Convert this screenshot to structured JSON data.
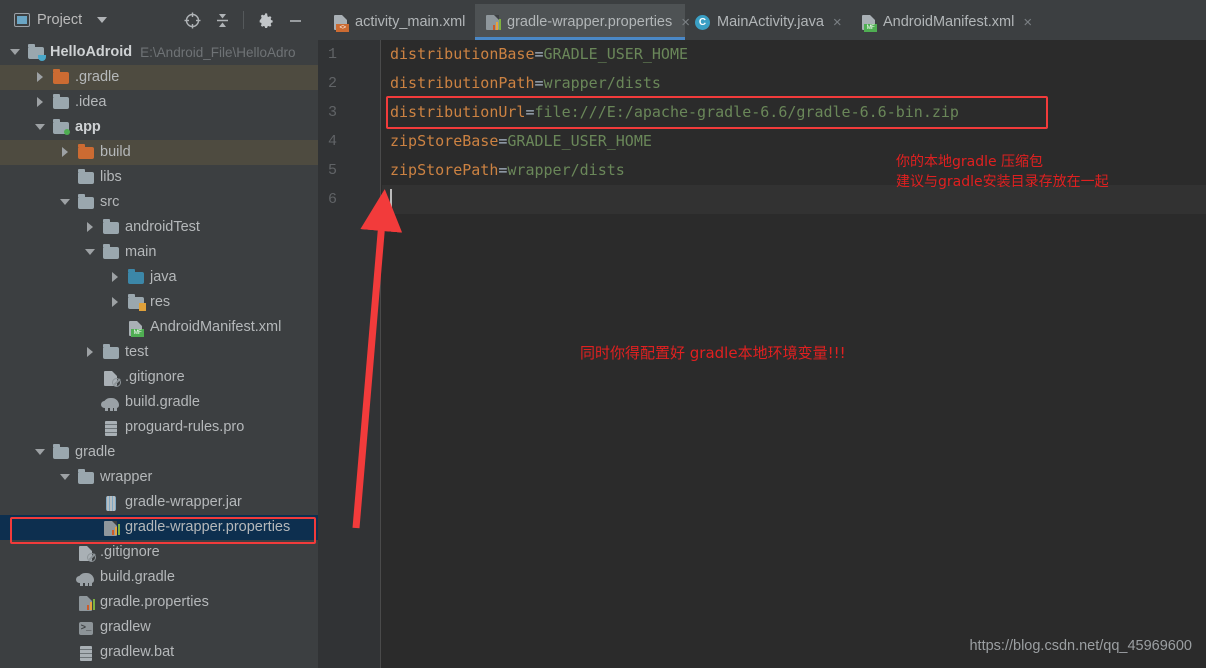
{
  "window": {
    "tool_window_title": "Project",
    "project_path": "E:\\Android_File\\HelloAdroid"
  },
  "toolbar": {
    "icons": [
      {
        "name": "locate-icon",
        "glyph": "⊕"
      },
      {
        "name": "collapse-all-icon",
        "glyph": "⤓"
      },
      {
        "name": "settings-gear-icon",
        "glyph": "⚙"
      },
      {
        "name": "minimize-icon",
        "glyph": "—"
      }
    ]
  },
  "tree": {
    "items": [
      {
        "label": "HelloAdroid",
        "note": "E:\\Android_File\\HelloAdro",
        "indent": 0,
        "twisty": "down",
        "icon": "folder-module",
        "bold": true,
        "state": "normal"
      },
      {
        "label": ".gradle",
        "note": "",
        "indent": 1,
        "twisty": "right",
        "icon": "folder-orange",
        "bold": false,
        "state": "olive"
      },
      {
        "label": ".idea",
        "note": "",
        "indent": 1,
        "twisty": "right",
        "icon": "folder-gray",
        "bold": false,
        "state": "normal"
      },
      {
        "label": "app",
        "note": "",
        "indent": 1,
        "twisty": "down",
        "icon": "folder-module-green",
        "bold": true,
        "state": "normal"
      },
      {
        "label": "build",
        "note": "",
        "indent": 2,
        "twisty": "right",
        "icon": "folder-orange",
        "bold": false,
        "state": "olive"
      },
      {
        "label": "libs",
        "note": "",
        "indent": 2,
        "twisty": "none",
        "icon": "folder-gray",
        "bold": false,
        "state": "normal"
      },
      {
        "label": "src",
        "note": "",
        "indent": 2,
        "twisty": "down",
        "icon": "folder-gray",
        "bold": false,
        "state": "normal"
      },
      {
        "label": "androidTest",
        "note": "",
        "indent": 3,
        "twisty": "right",
        "icon": "folder-gray",
        "bold": false,
        "state": "normal"
      },
      {
        "label": "main",
        "note": "",
        "indent": 3,
        "twisty": "down",
        "icon": "folder-gray",
        "bold": false,
        "state": "normal"
      },
      {
        "label": "java",
        "note": "",
        "indent": 4,
        "twisty": "right",
        "icon": "folder-blue",
        "bold": false,
        "state": "normal"
      },
      {
        "label": "res",
        "note": "",
        "indent": 4,
        "twisty": "right",
        "icon": "folder-res",
        "bold": false,
        "state": "normal"
      },
      {
        "label": "AndroidManifest.xml",
        "note": "",
        "indent": 4,
        "twisty": "none",
        "icon": "file-manifest",
        "bold": false,
        "state": "normal"
      },
      {
        "label": "test",
        "note": "",
        "indent": 3,
        "twisty": "right",
        "icon": "folder-gray",
        "bold": false,
        "state": "normal"
      },
      {
        "label": ".gitignore",
        "note": "",
        "indent": 3,
        "twisty": "none",
        "icon": "file-gitignore",
        "bold": false,
        "state": "normal"
      },
      {
        "label": "build.gradle",
        "note": "",
        "indent": 3,
        "twisty": "none",
        "icon": "file-gradle",
        "bold": false,
        "state": "normal"
      },
      {
        "label": "proguard-rules.pro",
        "note": "",
        "indent": 3,
        "twisty": "none",
        "icon": "file-text",
        "bold": false,
        "state": "normal"
      },
      {
        "label": "gradle",
        "note": "",
        "indent": 1,
        "twisty": "down",
        "icon": "folder-gray",
        "bold": false,
        "state": "normal"
      },
      {
        "label": "wrapper",
        "note": "",
        "indent": 2,
        "twisty": "down",
        "icon": "folder-gray",
        "bold": false,
        "state": "normal"
      },
      {
        "label": "gradle-wrapper.jar",
        "note": "",
        "indent": 3,
        "twisty": "none",
        "icon": "file-jar",
        "bold": false,
        "state": "normal"
      },
      {
        "label": "gradle-wrapper.properties",
        "note": "",
        "indent": 3,
        "twisty": "none",
        "icon": "file-properties",
        "bold": false,
        "state": "selected"
      },
      {
        "label": ".gitignore",
        "note": "",
        "indent": 2,
        "twisty": "none",
        "icon": "file-gitignore",
        "bold": false,
        "state": "normal"
      },
      {
        "label": "build.gradle",
        "note": "",
        "indent": 2,
        "twisty": "none",
        "icon": "file-gradle",
        "bold": false,
        "state": "normal"
      },
      {
        "label": "gradle.properties",
        "note": "",
        "indent": 2,
        "twisty": "none",
        "icon": "file-properties",
        "bold": false,
        "state": "normal"
      },
      {
        "label": "gradlew",
        "note": "",
        "indent": 2,
        "twisty": "none",
        "icon": "file-sh",
        "bold": false,
        "state": "normal"
      },
      {
        "label": "gradlew.bat",
        "note": "",
        "indent": 2,
        "twisty": "none",
        "icon": "file-text",
        "bold": false,
        "state": "normal"
      }
    ]
  },
  "tabs": [
    {
      "label": "activity_main.xml",
      "icon": "xml-layout-icon",
      "active": false
    },
    {
      "label": "gradle-wrapper.properties",
      "icon": "properties-icon",
      "active": true
    },
    {
      "label": "MainActivity.java",
      "icon": "java-class-icon",
      "active": false
    },
    {
      "label": "AndroidManifest.xml",
      "icon": "manifest-icon",
      "active": false
    }
  ],
  "editor": {
    "line_numbers": [
      "1",
      "2",
      "3",
      "4",
      "5",
      "6"
    ],
    "lines": [
      {
        "key": "distributionBase",
        "sep": "=",
        "value": "GRADLE_USER_HOME"
      },
      {
        "key": "distributionPath",
        "sep": "=",
        "value": "wrapper/dists"
      },
      {
        "key": "distributionUrl",
        "sep": "=",
        "value": "file:///E:/apache-gradle-6.6/gradle-6.6-bin.zip"
      },
      {
        "key": "zipStoreBase",
        "sep": "=",
        "value": "GRADLE_USER_HOME"
      },
      {
        "key": "zipStorePath",
        "sep": "=",
        "value": "wrapper/dists"
      },
      {
        "key": "",
        "sep": "",
        "value": ""
      }
    ]
  },
  "annotations": {
    "note_right_line1": "你的本地gradle 压缩包",
    "note_right_line2": "建议与gradle安装目录存放在一起",
    "note_center": "同时你得配置好 gradle本地环境变量!!!",
    "watermark": "https://blog.csdn.net/qq_45969600"
  },
  "colors": {
    "accent_red": "#f23b3b",
    "tab_underline": "#4a88c7",
    "selection_blue": "#0d2f4f",
    "olive_highlight": "#4e4b40",
    "key_orange": "#cc8242",
    "value_green": "#6a8759"
  }
}
